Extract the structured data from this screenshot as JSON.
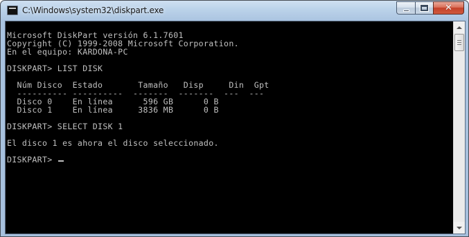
{
  "window": {
    "title": "C:\\Windows\\system32\\diskpart.exe",
    "icon": "console-icon",
    "buttons": {
      "minimize": "minimize-icon",
      "maximize": "maximize-icon",
      "close": "✕"
    }
  },
  "console": {
    "colors": {
      "background": "#000000",
      "text": "#c0c0c0"
    },
    "lines": [
      "Microsoft DiskPart versión 6.1.7601",
      "Copyright (C) 1999-2008 Microsoft Corporation.",
      "En el equipo: KARDONA-PC",
      "",
      "DISKPART> LIST DISK",
      "",
      "  Núm Disco  Estado       Tamaño   Disp     Din  Gpt",
      "  ---------- ----------  -------  -------  ---  ---",
      "  Disco 0    En línea      596 GB      0 B",
      "  Disco 1    En línea     3836 MB      0 B",
      "",
      "DISKPART> SELECT DISK 1",
      "",
      "El disco 1 es ahora el disco seleccionado.",
      "",
      "DISKPART> "
    ]
  },
  "scrollbar": {
    "position": "top"
  }
}
